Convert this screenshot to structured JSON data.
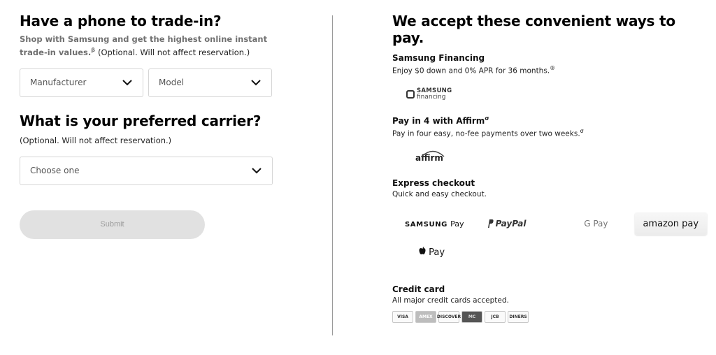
{
  "tradein": {
    "title": "Have a phone to trade-in?",
    "subtitle": "Shop with Samsung and get the highest online instant trade-in values.",
    "sup": "β",
    "optional": "(Optional. Will not affect reservation.)",
    "manufacturer_placeholder": "Manufacturer",
    "model_placeholder": "Model"
  },
  "carrier": {
    "title": "What is your preferred carrier?",
    "optional": "(Optional. Will not affect reservation.)",
    "placeholder": "Choose one"
  },
  "submit_label": "Submit",
  "payments": {
    "title": "We accept these convenient ways to pay.",
    "financing": {
      "title": "Samsung Financing",
      "desc": "Enjoy $0 down and 0% APR for 36 months.",
      "sup": "®",
      "logo_line1": "SAMSUNG",
      "logo_line2": "financing"
    },
    "affirm": {
      "title": "Pay in 4 with Affirm",
      "title_sup": "σ",
      "desc": "Pay in four easy, no-fee payments over two weeks.",
      "desc_sup": "σ",
      "logo": "affirm"
    },
    "express": {
      "title": "Express checkout",
      "desc": "Quick and easy checkout.",
      "samsung_pay_brand": "SAMSUNG",
      "samsung_pay_word": "Pay",
      "paypal": "PayPal",
      "gpay_g": "G",
      "gpay_word": "Pay",
      "amazon_pay": "amazon pay",
      "apple_pay": "Pay"
    },
    "credit": {
      "title": "Credit card",
      "desc": "All major credit cards accepted.",
      "cards": [
        "VISA",
        "AMEX",
        "DISCOVER",
        "MC",
        "JCB",
        "DINERS"
      ]
    }
  }
}
